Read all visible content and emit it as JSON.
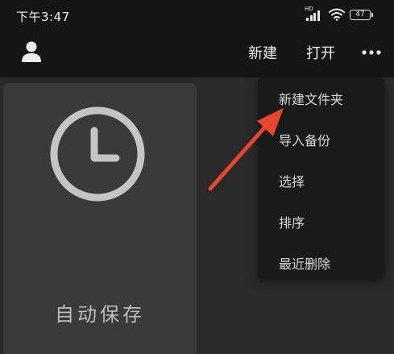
{
  "status_bar": {
    "time": "下午3:47",
    "hd_label": "HD",
    "battery": "47"
  },
  "app_bar": {
    "new_label": "新建",
    "open_label": "打开"
  },
  "menu": {
    "items": [
      {
        "label": "新建文件夹"
      },
      {
        "label": "导入备份"
      },
      {
        "label": "选择"
      },
      {
        "label": "排序"
      },
      {
        "label": "最近删除"
      }
    ]
  },
  "card": {
    "label": "自动保存"
  },
  "colors": {
    "top_bar": "#151515",
    "background": "#2a2a2a",
    "card": "#3a3a3a",
    "menu": "#1a1a1a",
    "annotation_arrow": "#e8452c"
  },
  "icons": {
    "avatar": "user-icon",
    "more": "more-dots-icon",
    "card": "clock-icon",
    "wifi": "wifi-icon",
    "signal": "signal-icon",
    "battery": "battery-icon"
  }
}
